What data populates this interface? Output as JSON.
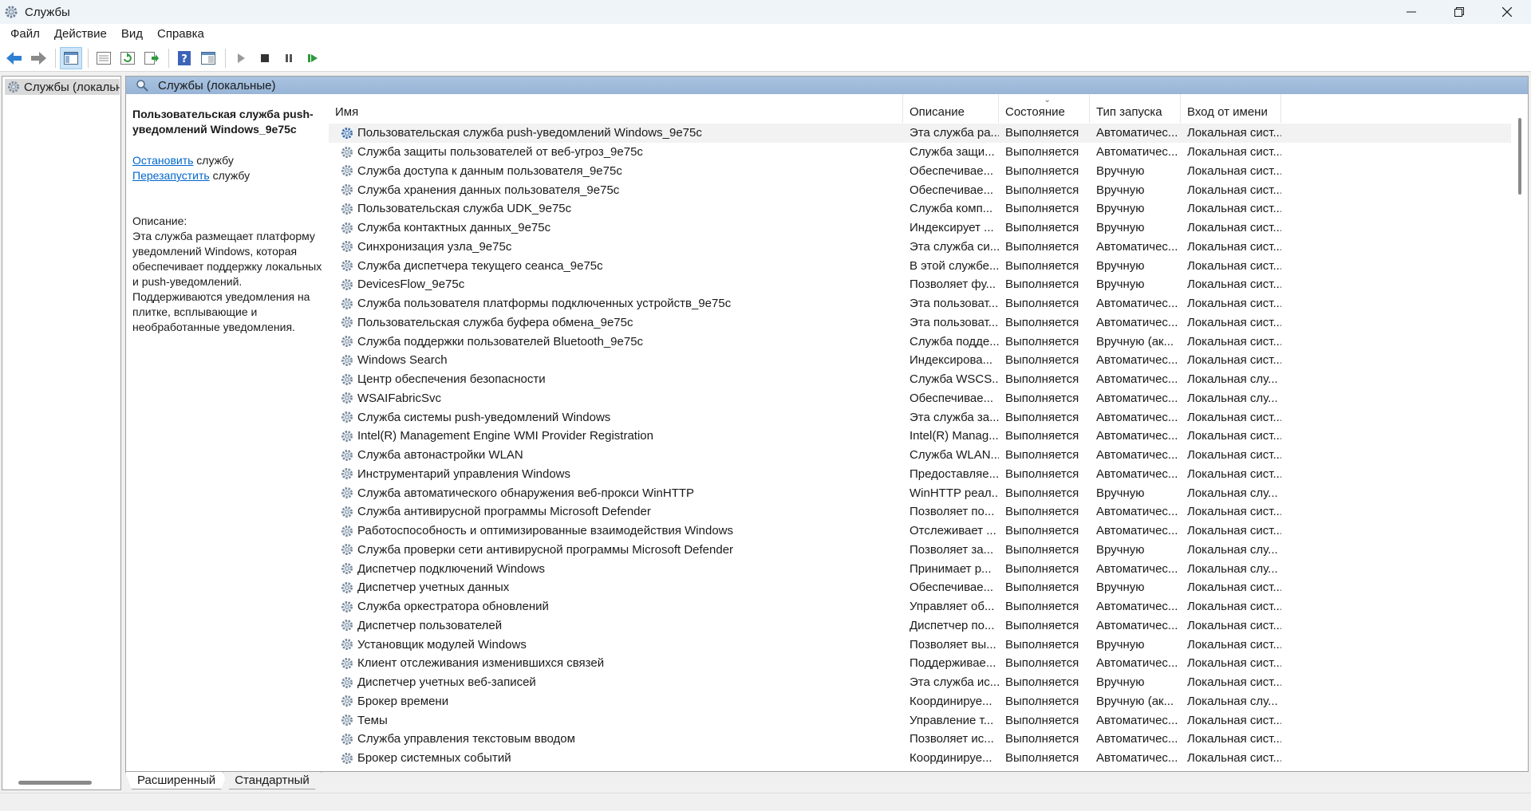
{
  "window": {
    "title": "Службы"
  },
  "menu": [
    "Файл",
    "Действие",
    "Вид",
    "Справка"
  ],
  "tree": {
    "root_label": "Службы (локальные)"
  },
  "content_header": {
    "title": "Службы (локальные)"
  },
  "details": {
    "service_title": "Пользовательская служба push-уведомлений Windows_9e75c",
    "stop_link": "Остановить",
    "stop_suffix": " службу",
    "restart_link": "Перезапустить",
    "restart_suffix": " службу",
    "desc_label": "Описание:",
    "desc_text": "Эта служба размещает платформу уведомлений Windows, которая обеспечивает поддержку локальных и push-уведомлений. Поддерживаются уведомления на плитке, всплывающие и необработанные уведомления."
  },
  "columns": {
    "name": "Имя",
    "description": "Описание",
    "state": "Состояние",
    "startup": "Тип запуска",
    "login": "Вход от имени"
  },
  "services": [
    {
      "name": "Пользовательская служба push-уведомлений Windows_9e75c",
      "desc": "Эта служба ра...",
      "state": "Выполняется",
      "startup": "Автоматичес...",
      "login": "Локальная сист...",
      "selected": true
    },
    {
      "name": "Служба защиты пользователей от веб-угроз_9e75c",
      "desc": "Служба защи...",
      "state": "Выполняется",
      "startup": "Автоматичес...",
      "login": "Локальная сист..."
    },
    {
      "name": "Служба доступа к данным пользователя_9e75c",
      "desc": "Обеспечивае...",
      "state": "Выполняется",
      "startup": "Вручную",
      "login": "Локальная сист..."
    },
    {
      "name": "Служба хранения данных пользователя_9e75c",
      "desc": "Обеспечивае...",
      "state": "Выполняется",
      "startup": "Вручную",
      "login": "Локальная сист..."
    },
    {
      "name": "Пользовательская служба UDK_9e75c",
      "desc": "Служба комп...",
      "state": "Выполняется",
      "startup": "Вручную",
      "login": "Локальная сист..."
    },
    {
      "name": "Служба контактных данных_9e75c",
      "desc": "Индексирует ...",
      "state": "Выполняется",
      "startup": "Вручную",
      "login": "Локальная сист..."
    },
    {
      "name": "Синхронизация узла_9e75c",
      "desc": "Эта служба си...",
      "state": "Выполняется",
      "startup": "Автоматичес...",
      "login": "Локальная сист..."
    },
    {
      "name": "Служба диспетчера текущего сеанса_9e75c",
      "desc": "В этой службе...",
      "state": "Выполняется",
      "startup": "Вручную",
      "login": "Локальная сист..."
    },
    {
      "name": "DevicesFlow_9e75c",
      "desc": "Позволяет фу...",
      "state": "Выполняется",
      "startup": "Вручную",
      "login": "Локальная сист..."
    },
    {
      "name": "Служба пользователя платформы подключенных устройств_9e75c",
      "desc": "Эта пользоват...",
      "state": "Выполняется",
      "startup": "Автоматичес...",
      "login": "Локальная сист..."
    },
    {
      "name": "Пользовательская служба буфера обмена_9e75c",
      "desc": "Эта пользоват...",
      "state": "Выполняется",
      "startup": "Автоматичес...",
      "login": "Локальная сист..."
    },
    {
      "name": "Служба поддержки пользователей Bluetooth_9e75c",
      "desc": "Служба подде...",
      "state": "Выполняется",
      "startup": "Вручную (ак...",
      "login": "Локальная сист..."
    },
    {
      "name": "Windows Search",
      "desc": "Индексирова...",
      "state": "Выполняется",
      "startup": "Автоматичес...",
      "login": "Локальная сист..."
    },
    {
      "name": "Центр обеспечения безопасности",
      "desc": "Служба WSCS...",
      "state": "Выполняется",
      "startup": "Автоматичес...",
      "login": "Локальная слу..."
    },
    {
      "name": "WSAIFabricSvc",
      "desc": "Обеспечивае...",
      "state": "Выполняется",
      "startup": "Автоматичес...",
      "login": "Локальная слу..."
    },
    {
      "name": "Служба системы push-уведомлений Windows",
      "desc": "Эта служба за...",
      "state": "Выполняется",
      "startup": "Автоматичес...",
      "login": "Локальная сист..."
    },
    {
      "name": "Intel(R) Management Engine WMI Provider Registration",
      "desc": "Intel(R) Manag...",
      "state": "Выполняется",
      "startup": "Автоматичес...",
      "login": "Локальная сист..."
    },
    {
      "name": "Служба автонастройки WLAN",
      "desc": "Служба WLAN...",
      "state": "Выполняется",
      "startup": "Автоматичес...",
      "login": "Локальная сист..."
    },
    {
      "name": "Инструментарий управления Windows",
      "desc": "Предоставляе...",
      "state": "Выполняется",
      "startup": "Автоматичес...",
      "login": "Локальная сист..."
    },
    {
      "name": "Служба автоматического обнаружения веб-прокси WinHTTP",
      "desc": "WinHTTP реал...",
      "state": "Выполняется",
      "startup": "Вручную",
      "login": "Локальная слу..."
    },
    {
      "name": "Служба антивирусной программы Microsoft Defender",
      "desc": "Позволяет по...",
      "state": "Выполняется",
      "startup": "Автоматичес...",
      "login": "Локальная сист..."
    },
    {
      "name": "Работоспособность и оптимизированные взаимодействия Windows",
      "desc": "Отслеживает ...",
      "state": "Выполняется",
      "startup": "Автоматичес...",
      "login": "Локальная сист..."
    },
    {
      "name": "Служба проверки сети антивирусной программы Microsoft Defender",
      "desc": "Позволяет за...",
      "state": "Выполняется",
      "startup": "Вручную",
      "login": "Локальная слу..."
    },
    {
      "name": "Диспетчер подключений Windows",
      "desc": "Принимает р...",
      "state": "Выполняется",
      "startup": "Автоматичес...",
      "login": "Локальная слу..."
    },
    {
      "name": "Диспетчер учетных данных",
      "desc": "Обеспечивае...",
      "state": "Выполняется",
      "startup": "Вручную",
      "login": "Локальная сист..."
    },
    {
      "name": "Служба оркестратора обновлений",
      "desc": "Управляет об...",
      "state": "Выполняется",
      "startup": "Автоматичес...",
      "login": "Локальная сист..."
    },
    {
      "name": "Диспетчер пользователей",
      "desc": "Диспетчер по...",
      "state": "Выполняется",
      "startup": "Автоматичес...",
      "login": "Локальная сист..."
    },
    {
      "name": "Установщик модулей Windows",
      "desc": "Позволяет вы...",
      "state": "Выполняется",
      "startup": "Вручную",
      "login": "Локальная сист..."
    },
    {
      "name": "Клиент отслеживания изменившихся связей",
      "desc": "Поддерживае...",
      "state": "Выполняется",
      "startup": "Автоматичес...",
      "login": "Локальная сист..."
    },
    {
      "name": "Диспетчер учетных веб-записей",
      "desc": "Эта служба ис...",
      "state": "Выполняется",
      "startup": "Вручную",
      "login": "Локальная сист..."
    },
    {
      "name": "Брокер времени",
      "desc": "Координируе...",
      "state": "Выполняется",
      "startup": "Вручную (ак...",
      "login": "Локальная слу..."
    },
    {
      "name": "Темы",
      "desc": "Управление т...",
      "state": "Выполняется",
      "startup": "Автоматичес...",
      "login": "Локальная сист..."
    },
    {
      "name": "Служба управления текстовым вводом",
      "desc": "Позволяет ис...",
      "state": "Выполняется",
      "startup": "Автоматичес...",
      "login": "Локальная сист..."
    },
    {
      "name": "Брокер системных событий",
      "desc": "Координируе...",
      "state": "Выполняется",
      "startup": "Автоматичес...",
      "login": "Локальная сист..."
    }
  ],
  "tabs": [
    "Расширенный",
    "Стандартный"
  ],
  "colors": {
    "header_bg": "#a9c3e0",
    "link": "#0066cc",
    "selected_row": "#f2f2f2"
  }
}
